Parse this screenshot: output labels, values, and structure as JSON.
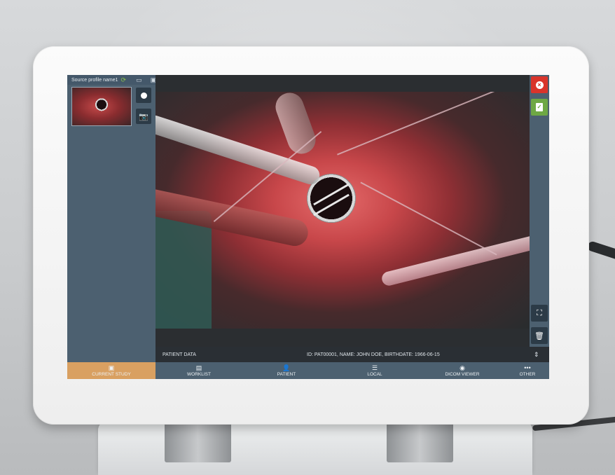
{
  "source": {
    "profile_name": "Source profile name1",
    "icons": [
      "sync-icon",
      "cast-icon",
      "camera-settings-icon"
    ]
  },
  "left_panel": {
    "record_icon": "record-icon",
    "snapshot_icon": "snapshot-icon"
  },
  "right_bar": {
    "close_icon": "close-icon",
    "confirm_icon": "clipboard-check-icon",
    "expand_icon": "expand-icon",
    "trash_icon": "trash-icon"
  },
  "patient_bar": {
    "label": "PATIENT DATA",
    "info": "ID: PAT00001, NAME: JOHN DOE, BIRTHDATE: 1966-06-15"
  },
  "nav": {
    "items": [
      {
        "label": "CURRENT STUDY",
        "icon": "study-icon",
        "active": true
      },
      {
        "label": "WORKLIST",
        "icon": "worklist-icon",
        "active": false
      },
      {
        "label": "PATIENT",
        "icon": "add-patient-icon",
        "active": false
      },
      {
        "label": "LOCAL",
        "icon": "list-icon",
        "active": false
      },
      {
        "label": "DICOM VIEWER",
        "icon": "eye-icon",
        "active": false
      },
      {
        "label": "OTHER",
        "icon": "more-icon",
        "active": false
      }
    ]
  },
  "colors": {
    "panel": "#4c6070",
    "active_tab": "#d9a061",
    "close": "#d9342b",
    "confirm": "#6ea844"
  }
}
